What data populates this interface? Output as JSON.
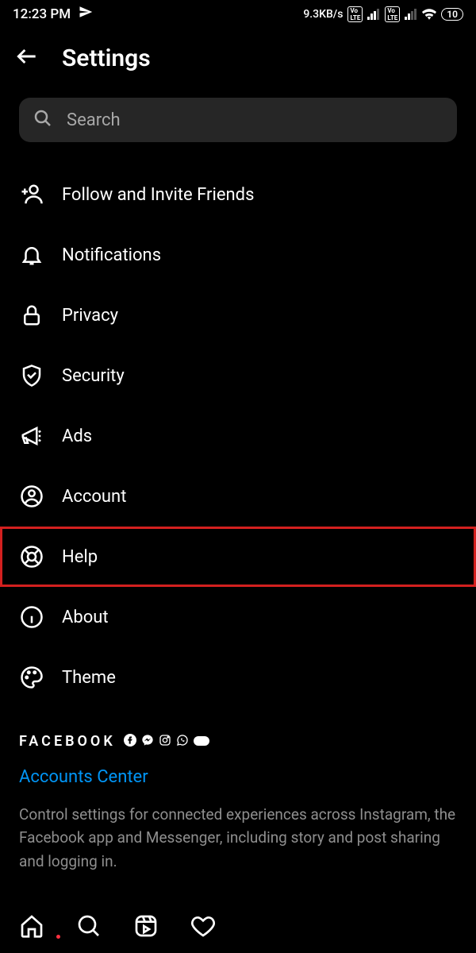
{
  "status": {
    "time": "12:23 PM",
    "net_speed": "9.3KB/s",
    "battery": "10"
  },
  "header": {
    "title": "Settings"
  },
  "search": {
    "placeholder": "Search"
  },
  "menu": {
    "follow_invite": "Follow and Invite Friends",
    "notifications": "Notifications",
    "privacy": "Privacy",
    "security": "Security",
    "ads": "Ads",
    "account": "Account",
    "help": "Help",
    "about": "About",
    "theme": "Theme"
  },
  "facebook": {
    "label": "FACEBOOK",
    "accounts_center": "Accounts Center",
    "description": "Control settings for connected experiences across Instagram, the Facebook app and Messenger, including story and post sharing and logging in."
  }
}
